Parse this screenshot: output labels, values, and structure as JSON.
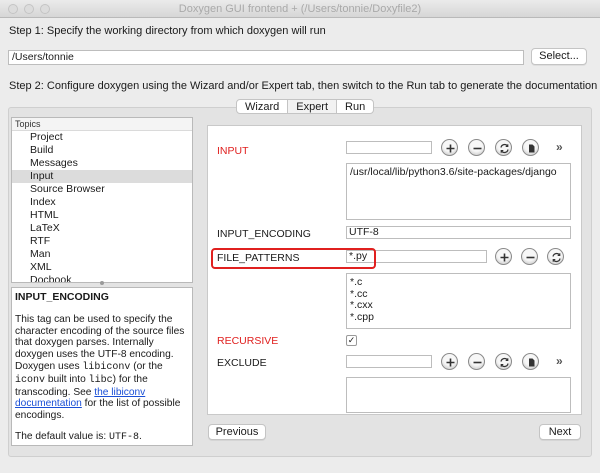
{
  "window": {
    "title": "Doxygen GUI frontend + (/Users/tonnie/Doxyfile2)"
  },
  "step1": {
    "label": "Step 1: Specify the working directory from which doxygen will run",
    "working_dir": "/Users/tonnie",
    "select_button": "Select..."
  },
  "step2": {
    "label": "Step 2: Configure doxygen using the Wizard and/or Expert tab, then switch to the Run tab to generate the documentation"
  },
  "tabs": [
    {
      "label": "Wizard"
    },
    {
      "label": "Expert",
      "selected": true
    },
    {
      "label": "Run"
    }
  ],
  "topics": {
    "header": "Topics",
    "items": [
      "Project",
      "Build",
      "Messages",
      "Input",
      "Source Browser",
      "Index",
      "HTML",
      "LaTeX",
      "RTF",
      "Man",
      "XML",
      "Docbook"
    ],
    "selected": "Input"
  },
  "help": {
    "title": "INPUT_ENCODING",
    "p1_a": "This tag can be used to specify the character encoding of the source files that doxygen parses. Internally doxygen uses the UTF-8 encoding. Doxygen uses ",
    "p1_code1": "libiconv",
    "p1_b": " (or the ",
    "p1_code2": "iconv",
    "p1_c": " built into ",
    "p1_code3": "libc",
    "p1_d": ") for the transcoding. See ",
    "p1_link": "the libiconv documentation",
    "p1_e": " for the list of possible encodings.",
    "p2_a": "The default value is: ",
    "p2_code": "UTF-8",
    "p2_b": "."
  },
  "options": {
    "input": {
      "label": "INPUT",
      "value": "",
      "list": [
        "/usr/local/lib/python3.6/site-packages/django"
      ]
    },
    "input_encoding": {
      "label": "INPUT_ENCODING",
      "value": "UTF-8"
    },
    "file_patterns": {
      "label": "FILE_PATTERNS",
      "value": "*.py",
      "list": [
        "*.c",
        "*.cc",
        "*.cxx",
        "*.cpp"
      ]
    },
    "recursive": {
      "label": "RECURSIVE",
      "checked": true,
      "check_glyph": "✓"
    },
    "exclude": {
      "label": "EXCLUDE",
      "value": ""
    }
  },
  "buttons": {
    "previous": "Previous",
    "next": "Next",
    "more": "»"
  },
  "colors": {
    "modified_label": "#e0201f",
    "highlight_border": "#e0201f",
    "link": "#1a4fd6"
  },
  "icons": [
    "add-icon",
    "remove-icon",
    "update-icon",
    "browse-file-icon",
    "more-icon"
  ]
}
